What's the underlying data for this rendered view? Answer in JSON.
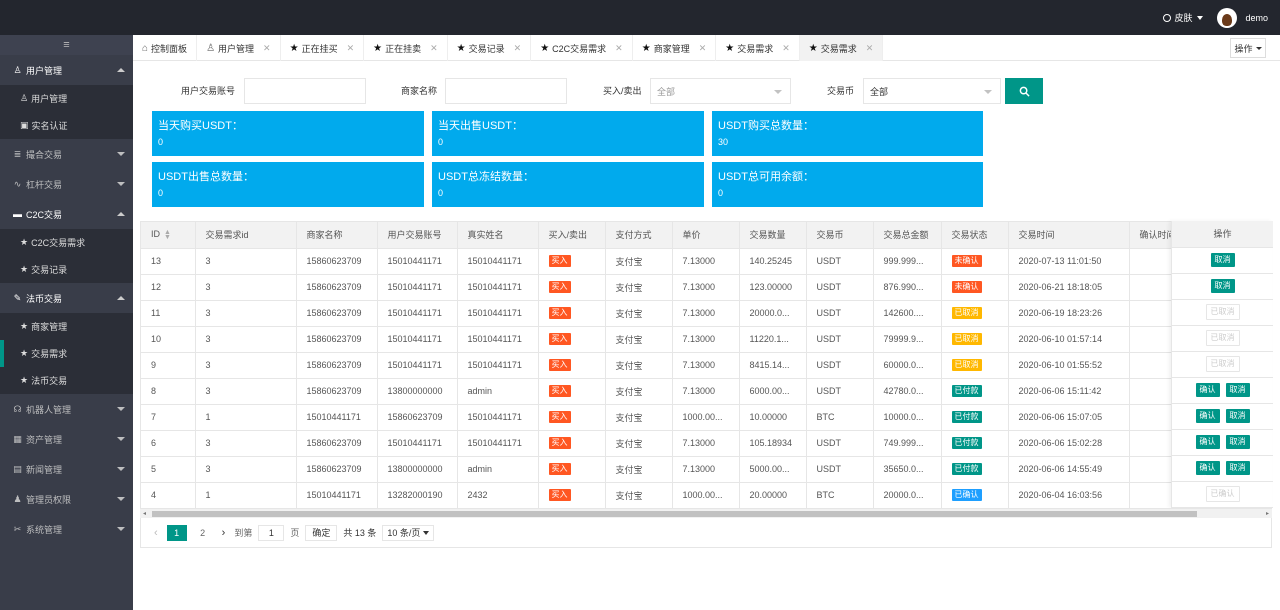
{
  "topbar": {
    "skin_label": "皮肤",
    "user": "demo"
  },
  "sidebar": {
    "toggle": "≡",
    "groups": [
      {
        "label": "用户管理",
        "icon": "user-icon",
        "open": true,
        "items": [
          {
            "label": "用户管理"
          },
          {
            "label": "实名认证"
          }
        ]
      },
      {
        "label": "撮合交易",
        "icon": "list-icon",
        "open": false
      },
      {
        "label": "杠杆交易",
        "icon": "pulse-icon",
        "open": false
      },
      {
        "label": "C2C交易",
        "icon": "chat-icon",
        "open": true,
        "items": [
          {
            "label": "C2C交易需求"
          },
          {
            "label": "交易记录"
          }
        ]
      },
      {
        "label": "法币交易",
        "icon": "wrench-icon",
        "open": true,
        "items": [
          {
            "label": "商家管理"
          },
          {
            "label": "交易需求"
          },
          {
            "label": "法币交易"
          }
        ]
      },
      {
        "label": "机器人管理",
        "icon": "headset-icon",
        "open": false
      },
      {
        "label": "资产管理",
        "icon": "grid-icon",
        "open": false
      },
      {
        "label": "新闻管理",
        "icon": "file-icon",
        "open": false
      },
      {
        "label": "管理员权限",
        "icon": "users-icon",
        "open": false
      },
      {
        "label": "系统管理",
        "icon": "tools-icon",
        "open": false
      }
    ]
  },
  "tabs": [
    {
      "label": "控制面板",
      "icon": "home-icon"
    },
    {
      "label": "用户管理",
      "icon": "user-icon"
    },
    {
      "label": "正在挂买",
      "icon": "star-icon"
    },
    {
      "label": "正在挂卖",
      "icon": "star-icon"
    },
    {
      "label": "交易记录",
      "icon": "star-icon"
    },
    {
      "label": "C2C交易需求",
      "icon": "star-icon"
    },
    {
      "label": "商家管理",
      "icon": "star-icon"
    },
    {
      "label": "交易需求",
      "icon": "star-icon"
    },
    {
      "label": "交易需求",
      "icon": "star-icon",
      "active": true
    }
  ],
  "tabs_close": "✕",
  "operation_label": "操作",
  "filters": {
    "account_label": "用户交易账号",
    "merchant_label": "商家名称",
    "buysell_label": "买入/卖出",
    "buysell_value": "全部",
    "coin_label": "交易币",
    "coin_value": "全部"
  },
  "cards": [
    {
      "title": "当天购买USDT：",
      "value": "0"
    },
    {
      "title": "当天出售USDT：",
      "value": "0"
    },
    {
      "title": "USDT购买总数量：",
      "value": "30"
    },
    {
      "title": "USDT出售总数量：",
      "value": "0"
    },
    {
      "title": "USDT总冻结数量：",
      "value": "0"
    },
    {
      "title": "USDT总可用余额：",
      "value": "0"
    }
  ],
  "table": {
    "headers": [
      "ID",
      "交易需求id",
      "商家名称",
      "用户交易账号",
      "真实姓名",
      "买入/卖出",
      "支付方式",
      "单价",
      "交易数量",
      "交易币",
      "交易总金额",
      "交易状态",
      "交易时间",
      "确认时间",
      "操作"
    ],
    "rows": [
      {
        "id": "13",
        "req": "3",
        "merchant": "15860623709",
        "account": "15010441171",
        "name": "15010441171",
        "side": "买入",
        "pay": "支付宝",
        "price": "7.13000",
        "qty": "140.25245",
        "coin": "USDT",
        "total": "999.999...",
        "status": "未确认",
        "status_color": "#ff5722",
        "time": "2020-07-13 11:01:50",
        "ops": [
          "取消"
        ]
      },
      {
        "id": "12",
        "req": "3",
        "merchant": "15860623709",
        "account": "15010441171",
        "name": "15010441171",
        "side": "买入",
        "pay": "支付宝",
        "price": "7.13000",
        "qty": "123.00000",
        "coin": "USDT",
        "total": "876.990...",
        "status": "未确认",
        "status_color": "#ff5722",
        "time": "2020-06-21 18:18:05",
        "ops": [
          "取消"
        ]
      },
      {
        "id": "11",
        "req": "3",
        "merchant": "15860623709",
        "account": "15010441171",
        "name": "15010441171",
        "side": "买入",
        "pay": "支付宝",
        "price": "7.13000",
        "qty": "20000.0...",
        "coin": "USDT",
        "total": "142600....",
        "status": "已取消",
        "status_color": "#ffb800",
        "time": "2020-06-19 18:23:26",
        "ops": [
          "已取消"
        ],
        "ops_disabled": true
      },
      {
        "id": "10",
        "req": "3",
        "merchant": "15860623709",
        "account": "15010441171",
        "name": "15010441171",
        "side": "买入",
        "pay": "支付宝",
        "price": "7.13000",
        "qty": "11220.1...",
        "coin": "USDT",
        "total": "79999.9...",
        "status": "已取消",
        "status_color": "#ffb800",
        "time": "2020-06-10 01:57:14",
        "ops": [
          "已取消"
        ],
        "ops_disabled": true
      },
      {
        "id": "9",
        "req": "3",
        "merchant": "15860623709",
        "account": "15010441171",
        "name": "15010441171",
        "side": "买入",
        "pay": "支付宝",
        "price": "7.13000",
        "qty": "8415.14...",
        "coin": "USDT",
        "total": "60000.0...",
        "status": "已取消",
        "status_color": "#ffb800",
        "time": "2020-06-10 01:55:52",
        "ops": [
          "已取消"
        ],
        "ops_disabled": true
      },
      {
        "id": "8",
        "req": "3",
        "merchant": "15860623709",
        "account": "13800000000",
        "name": "admin",
        "side": "买入",
        "pay": "支付宝",
        "price": "7.13000",
        "qty": "6000.00...",
        "coin": "USDT",
        "total": "42780.0...",
        "status": "已付款",
        "status_color": "#009688",
        "time": "2020-06-06 15:11:42",
        "ops": [
          "确认",
          "取消"
        ]
      },
      {
        "id": "7",
        "req": "1",
        "merchant": "15010441171",
        "account": "15860623709",
        "name": "15010441171",
        "side": "买入",
        "pay": "支付宝",
        "price": "1000.00...",
        "qty": "10.00000",
        "coin": "BTC",
        "total": "10000.0...",
        "status": "已付款",
        "status_color": "#009688",
        "time": "2020-06-06 15:07:05",
        "ops": [
          "确认",
          "取消"
        ]
      },
      {
        "id": "6",
        "req": "3",
        "merchant": "15860623709",
        "account": "15010441171",
        "name": "15010441171",
        "side": "买入",
        "pay": "支付宝",
        "price": "7.13000",
        "qty": "105.18934",
        "coin": "USDT",
        "total": "749.999...",
        "status": "已付款",
        "status_color": "#009688",
        "time": "2020-06-06 15:02:28",
        "ops": [
          "确认",
          "取消"
        ]
      },
      {
        "id": "5",
        "req": "3",
        "merchant": "15860623709",
        "account": "13800000000",
        "name": "admin",
        "side": "买入",
        "pay": "支付宝",
        "price": "7.13000",
        "qty": "5000.00...",
        "coin": "USDT",
        "total": "35650.0...",
        "status": "已付款",
        "status_color": "#009688",
        "time": "2020-06-06 14:55:49",
        "ops": [
          "确认",
          "取消"
        ]
      },
      {
        "id": "4",
        "req": "1",
        "merchant": "15010441171",
        "account": "13282000190",
        "name": "2432",
        "side": "买入",
        "pay": "支付宝",
        "price": "1000.00...",
        "qty": "20.00000",
        "coin": "BTC",
        "total": "20000.0...",
        "status": "已确认",
        "status_color": "#1e9fff",
        "time": "2020-06-04 16:03:56",
        "ops": [
          "已确认"
        ],
        "ops_disabled": true
      }
    ]
  },
  "pager": {
    "pages": [
      "1",
      "2"
    ],
    "current": "1",
    "goto_label": "到第",
    "goto_value": "1",
    "page_label": "页",
    "confirm": "确定",
    "total": "共 13 条",
    "per_page": "10 条/页"
  }
}
